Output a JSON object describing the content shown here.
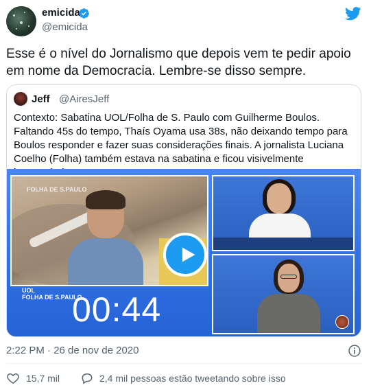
{
  "author": {
    "display_name": "emicida",
    "handle": "@emicida",
    "verified": true
  },
  "tweet": {
    "text": "Esse é o nível do Jornalismo que depois vem te pedir apoio em nome da Democracia. Lembre-se disso sempre."
  },
  "quoted_tweet": {
    "display_name": "Jeff",
    "handle": "@AiresJeff",
    "text": "Contexto: Sabatina UOL/Folha de S. Paulo com Guilherme Boulos. Faltando 45s do tempo, Thaís Oyama usa 38s, não deixando tempo para Boulos responder e fazer suas considerações finais. A jornalista Luciana Coelho (Folha) também estava na sabatina e ficou visivelmente incomodada.",
    "video": {
      "timer": "00:44",
      "logo_top": "FOLHA DE S.PAULO",
      "logo_bottom_1": "UOL",
      "logo_bottom_2": "FOLHA DE S.PAULO"
    }
  },
  "meta": {
    "timestamp": "2:22 PM · 26 de nov de 2020"
  },
  "actions": {
    "like_count": "15,7 mil",
    "reply_label": "2,4 mil pessoas estão tweetando sobre isso"
  },
  "colors": {
    "accent": "#1d9bf0",
    "secondary_text": "#536471",
    "video_blue": "#2f6fe2"
  },
  "icons": {
    "brand": "twitter-bird-icon",
    "verified": "verified-badge-icon",
    "play": "play-icon",
    "info": "info-icon",
    "like": "heart-icon",
    "reply": "speech-bubble-icon"
  }
}
